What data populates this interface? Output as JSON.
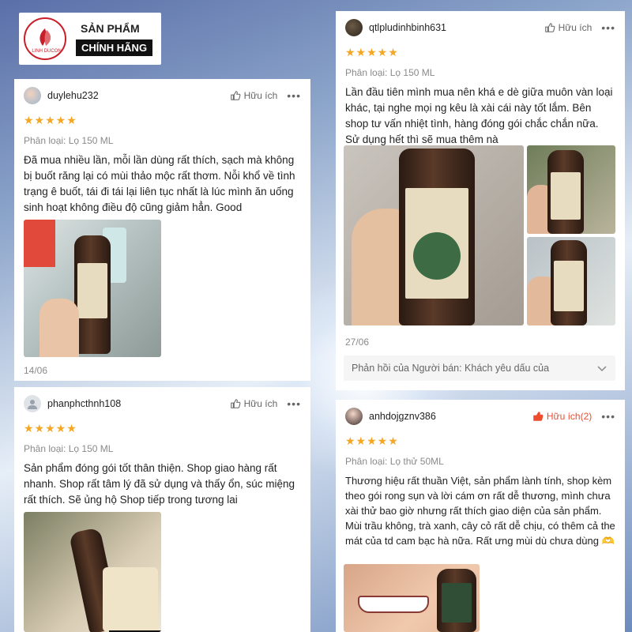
{
  "badge": {
    "line1": "SẢN PHẨM",
    "line2": "CHÍNH HÃNG",
    "logo_text": "LINH DUCON"
  },
  "colors": {
    "accent": "#ee4d2d",
    "star": "#f5a623",
    "badge_red": "#c81f2a"
  },
  "reviews": [
    {
      "username": "duylehu232",
      "helpful_label": "Hữu ích",
      "stars": "★★★★★",
      "variant": "Phân loại: Lọ 150 ML",
      "text": "Đã mua nhiều lần, mỗi lần dùng rất thích, sạch mà không bị buốt răng lại có mùi thảo mộc rất thơm. Nỗi khổ về tình trạng ê buốt, tái đi tái lại liên tục nhất là lúc mình ăn uống sinh hoạt không điều độ cũng giảm hẳn. Good",
      "date": "14/06"
    },
    {
      "username": "qtlpludinhbinh631",
      "helpful_label": "Hữu ích",
      "stars": "★★★★★",
      "variant": "Phân loại: Lọ 150 ML",
      "text": "Lần đầu tiên mình mua nên khá e dè giữa muôn vàn loại khác, tại nghe mọi ng kêu là xài cái này tốt lắm. Bên shop tư vấn nhiệt tình, hàng đóng gói chắc chắn nữa. Sử dụng hết thì sẽ mua thêm nà",
      "date": "27/06",
      "seller_reply": "Phản hồi của Người bán: Khách yêu dấu của"
    },
    {
      "username": "phanphcthnh108",
      "helpful_label": "Hữu ích",
      "stars": "★★★★★",
      "variant": "Phân loại: Lọ 150 ML",
      "text": "Sản phẩm đóng gói tốt thân thiện. Shop giao hàng rất nhanh. Shop rất tâm lý đã sử dụng và thấy ổn, súc miệng rất thích. Sẽ ủng hộ Shop tiếp trong tương lai"
    },
    {
      "username": "anhdojgznv386",
      "helpful_label": "Hữu ích(2)",
      "stars": "★★★★★",
      "variant": "Phân loại: Lọ thử 50ML",
      "text": "Thương hiệu rất thuần Việt, sản phẩm lành tính, shop kèm theo gói rong sụn và lời cám ơn rất dễ thương, mình chưa xài thử bao giờ nhưng rất thích giao diện của sản phẩm. Mùi trầu không, trà xanh, cây cỏ rất dễ chịu, có thêm cả the mát của td cam bạc hà nữa. Rất ưng mùi dù chưa dùng 🫶"
    }
  ]
}
